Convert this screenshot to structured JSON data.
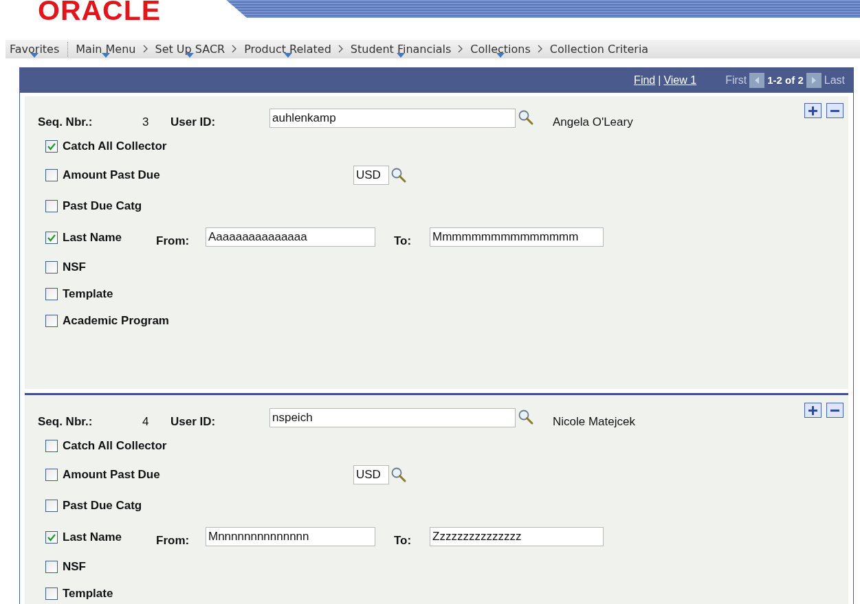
{
  "logo": {
    "text": "ORACLE"
  },
  "breadcrumb": [
    {
      "label": "Favorites",
      "has_menu": true,
      "kind": "favorites"
    },
    {
      "label": "Main Menu",
      "has_menu": true,
      "kind": "path"
    },
    {
      "label": "Set Up SACR",
      "has_menu": true,
      "kind": "path"
    },
    {
      "label": "Product Related",
      "has_menu": true,
      "kind": "path"
    },
    {
      "label": "Student Financials",
      "has_menu": true,
      "kind": "path"
    },
    {
      "label": "Collections",
      "has_menu": true,
      "kind": "path"
    },
    {
      "label": "Collection Criteria",
      "has_menu": false,
      "kind": "path"
    }
  ],
  "grid_header": {
    "find": "Find",
    "separator": "|",
    "view": "View 1",
    "first": "First",
    "count": "1-2 of 2",
    "last": "Last"
  },
  "records": [
    {
      "seq_label": "Seq. Nbr.:",
      "seq": "3",
      "user_label": "User ID:",
      "user_id": "auhlenkamp",
      "user_name": "Angela O'Leary",
      "options": [
        {
          "kind": "plain",
          "label": "Catch All Collector",
          "checked": true
        },
        {
          "kind": "currency",
          "label": "Amount Past Due",
          "checked": false,
          "currency": "USD"
        },
        {
          "kind": "plain",
          "label": "Past Due Catg",
          "checked": false
        },
        {
          "kind": "range",
          "label": "Last Name",
          "checked": true,
          "from_label": "From:",
          "from": "Aaaaaaaaaaaaaaa",
          "to_label": "To:",
          "to": "Mmmmmmmmmmmmmmm"
        },
        {
          "kind": "plain",
          "label": "NSF",
          "checked": false
        },
        {
          "kind": "plain",
          "label": "Template",
          "checked": false
        },
        {
          "kind": "plain",
          "label": "Academic Program",
          "checked": false
        }
      ]
    },
    {
      "seq_label": "Seq. Nbr.:",
      "seq": "4",
      "user_label": "User ID:",
      "user_id": "nspeich",
      "user_name": "Nicole Matejcek",
      "options": [
        {
          "kind": "plain",
          "label": "Catch All Collector",
          "checked": false
        },
        {
          "kind": "currency",
          "label": "Amount Past Due",
          "checked": false,
          "currency": "USD"
        },
        {
          "kind": "plain",
          "label": "Past Due Catg",
          "checked": false
        },
        {
          "kind": "range",
          "label": "Last Name",
          "checked": true,
          "from_label": "From:",
          "from": "Mnnnnnnnnnnnnnn",
          "to_label": "To:",
          "to": "Zzzzzzzzzzzzzzz"
        },
        {
          "kind": "plain",
          "label": "NSF",
          "checked": false
        },
        {
          "kind": "plain",
          "label": "Template",
          "checked": false
        }
      ]
    }
  ]
}
